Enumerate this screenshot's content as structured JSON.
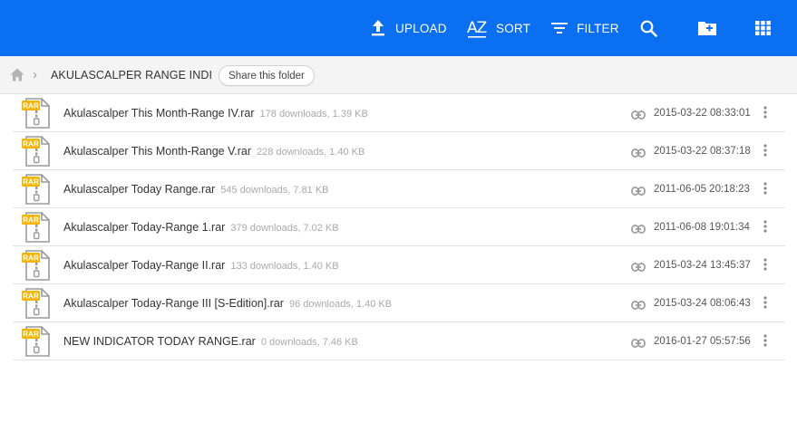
{
  "toolbar": {
    "upload_label": "UPLOAD",
    "sort_label": "SORT",
    "sort_icon_text": "AZ",
    "filter_label": "FILTER",
    "bg_color": "#0a6ff0",
    "icons": [
      "upload-icon",
      "sort-az-icon",
      "filter-icon",
      "search-icon",
      "new-folder-icon",
      "grid-view-icon"
    ]
  },
  "breadcrumb": {
    "separator": "›",
    "folder_name": "AKULASCALPER RANGE INDI",
    "share_label": "Share this folder"
  },
  "files": [
    {
      "name": "Akulascalper This Month-Range IV.rar",
      "meta": "178 downloads, 1.39 KB",
      "date": "2015-03-22 08:33:01",
      "badge": "RAR"
    },
    {
      "name": "Akulascalper This Month-Range V.rar",
      "meta": "228 downloads, 1.40 KB",
      "date": "2015-03-22 08:37:18",
      "badge": "RAR"
    },
    {
      "name": "Akulascalper Today Range.rar",
      "meta": "545 downloads, 7.81 KB",
      "date": "2011-06-05 20:18:23",
      "badge": "RAR"
    },
    {
      "name": "Akulascalper Today-Range 1.rar",
      "meta": "379 downloads, 7.02 KB",
      "date": "2011-06-08 19:01:34",
      "badge": "RAR"
    },
    {
      "name": "Akulascalper Today-Range II.rar",
      "meta": "133 downloads, 1.40 KB",
      "date": "2015-03-24 13:45:37",
      "badge": "RAR"
    },
    {
      "name": "Akulascalper Today-Range III [S-Edition].rar",
      "meta": "96 downloads, 1.40 KB",
      "date": "2015-03-24 08:06:43",
      "badge": "RAR"
    },
    {
      "name": "NEW INDICATOR TODAY RANGE.rar",
      "meta": "0 downloads, 7.46 KB",
      "date": "2016-01-27 05:57:56",
      "badge": "RAR"
    }
  ]
}
